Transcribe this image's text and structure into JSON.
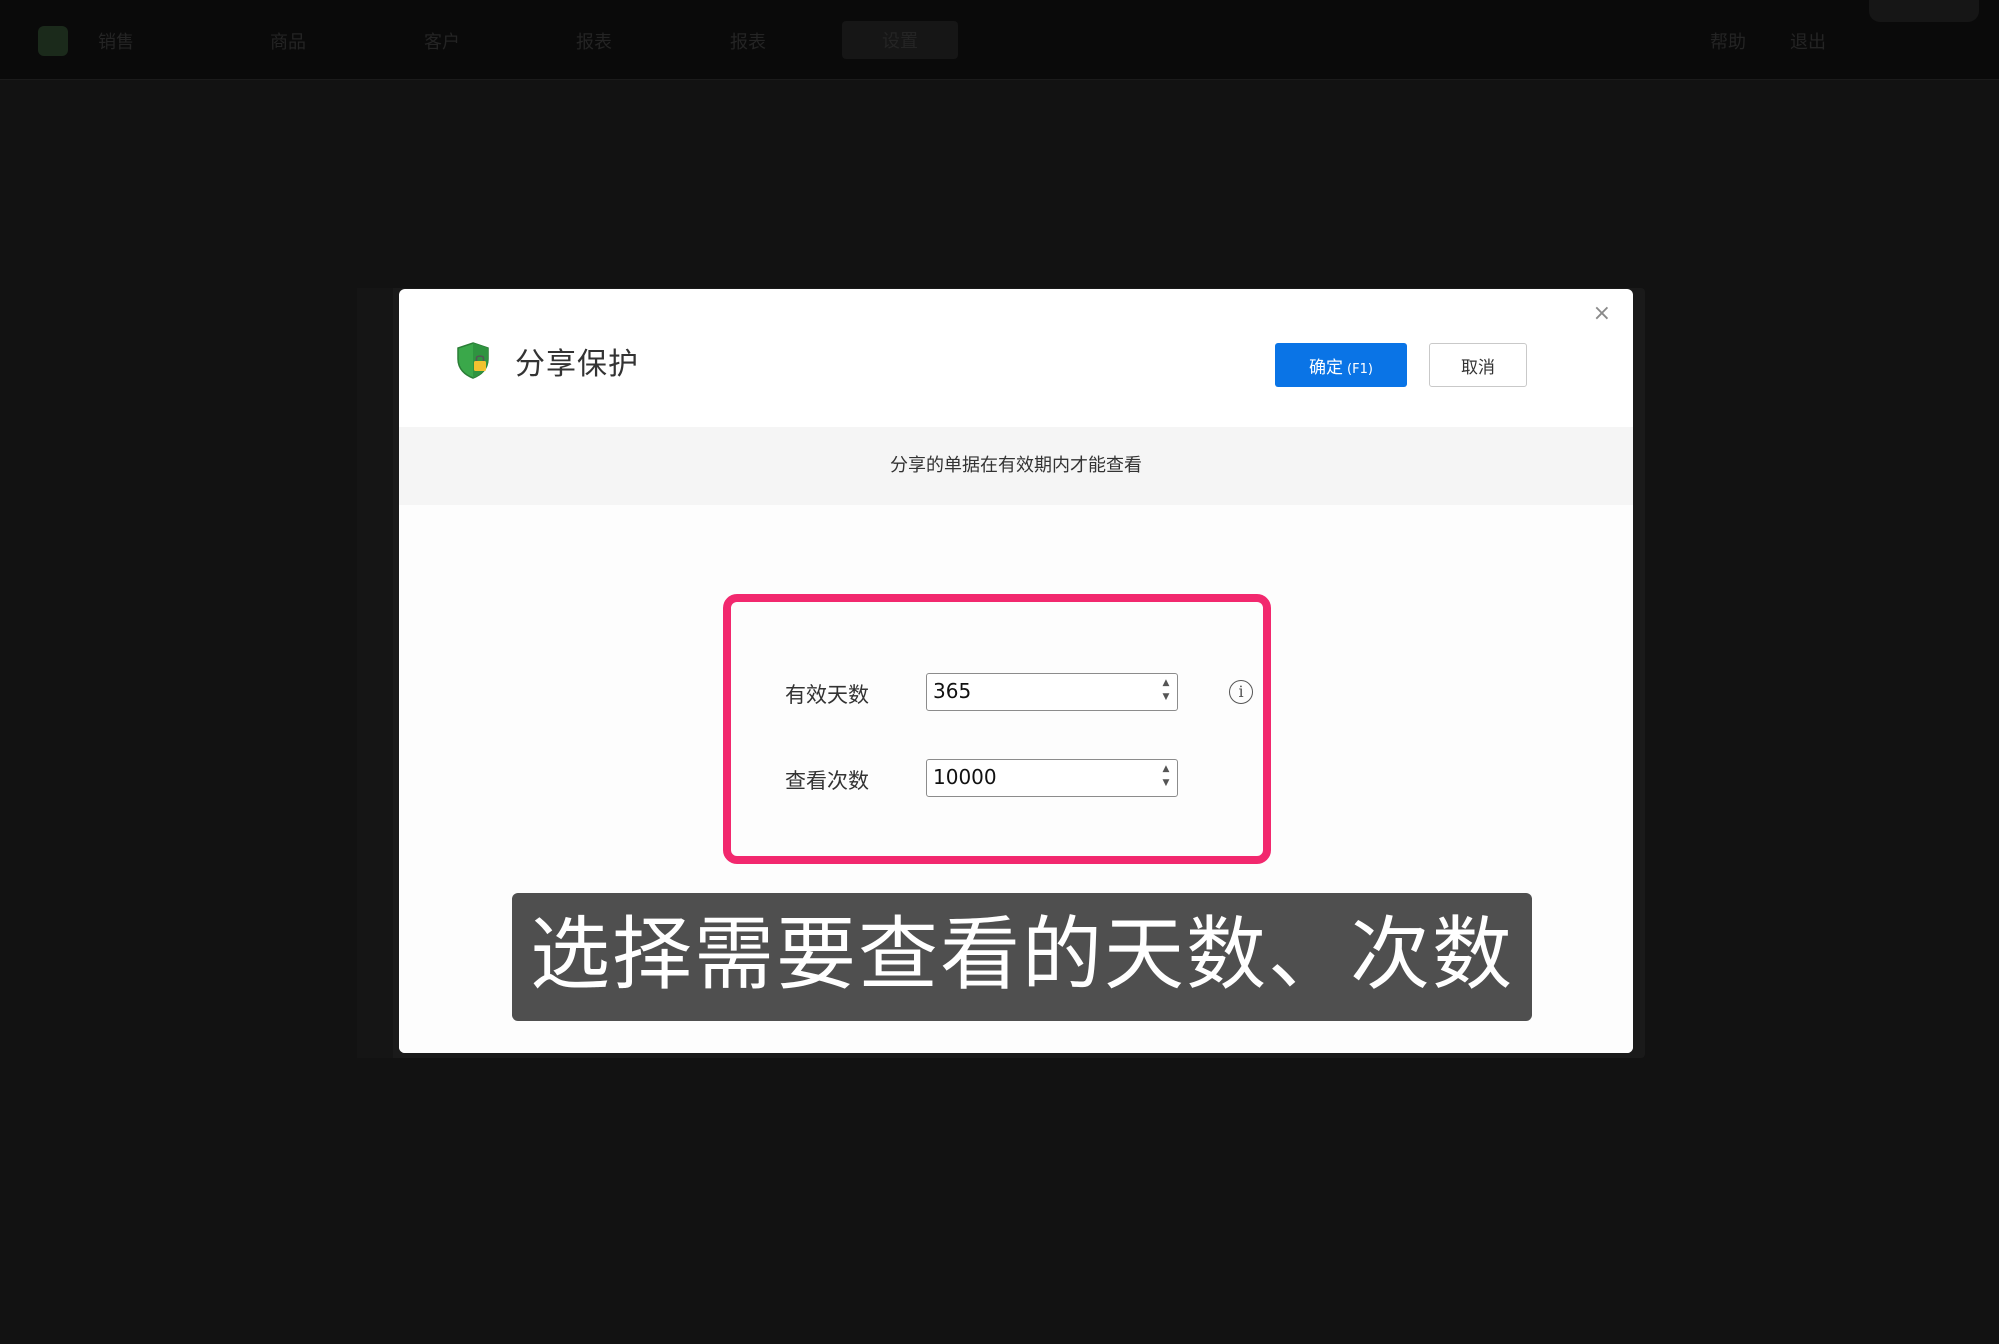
{
  "topbar": {
    "nav": [
      {
        "label": "销售"
      },
      {
        "label": "商品"
      },
      {
        "label": "客户"
      },
      {
        "label": "报表"
      },
      {
        "label": "报表"
      },
      {
        "label": "设置"
      }
    ],
    "right": [
      {
        "label": "帮助"
      },
      {
        "label": "退出"
      }
    ]
  },
  "modal": {
    "title": "分享保护",
    "confirm_label": "确定",
    "confirm_hint": "(F1)",
    "cancel_label": "取消",
    "close_symbol": "×",
    "notice": "分享的单据在有效期内才能查看",
    "fields": [
      {
        "label": "有效天数",
        "value": "365"
      },
      {
        "label": "查看次数",
        "value": "10000"
      }
    ],
    "info_symbol": "i"
  },
  "caption": "选择需要查看的天数、次数",
  "colors": {
    "primary": "#0a74e6",
    "highlight": "#f2286e",
    "shield": "#3aa84a"
  },
  "icons": [
    "shield-lock-icon",
    "close-icon",
    "info-icon",
    "spinner-up-icon",
    "spinner-down-icon"
  ]
}
